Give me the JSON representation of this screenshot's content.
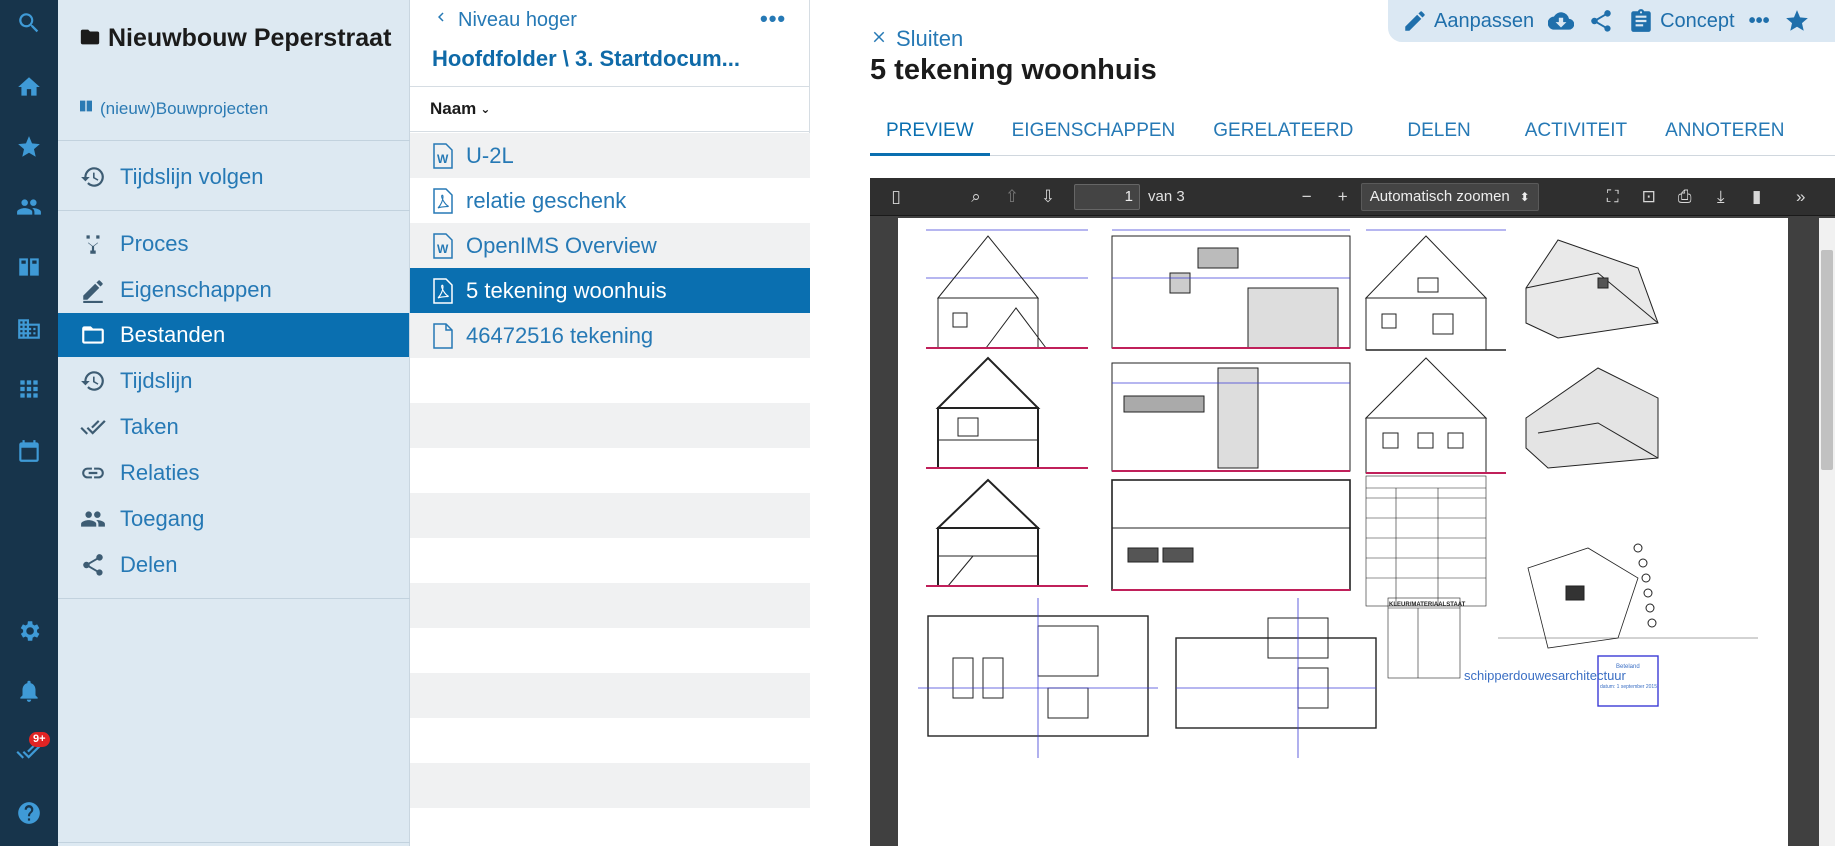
{
  "rail": {
    "icons": [
      "search-icon",
      "home-icon",
      "star-icon",
      "people-icon",
      "book-icon",
      "building-icon",
      "apps-icon",
      "calendar-icon",
      "gear-icon",
      "bell-icon",
      "tasks-icon",
      "help-icon"
    ],
    "badge": "9+"
  },
  "project": {
    "title": "Nieuwbouw Peperstraat",
    "subtitle": "(nieuw)Bouwprojecten",
    "follow": "Tijdslijn volgen",
    "nav": [
      {
        "label": "Proces",
        "icon": "process-icon"
      },
      {
        "label": "Eigenschappen",
        "icon": "edit-signature-icon"
      },
      {
        "label": "Bestanden",
        "icon": "folder-icon",
        "active": true
      },
      {
        "label": "Tijdslijn",
        "icon": "history-icon"
      },
      {
        "label": "Taken",
        "icon": "double-check-icon"
      },
      {
        "label": "Relaties",
        "icon": "link-icon"
      },
      {
        "label": "Toegang",
        "icon": "people-icon"
      },
      {
        "label": "Delen",
        "icon": "share-icon"
      }
    ]
  },
  "files": {
    "back_label": "Niveau hoger",
    "more": "•••",
    "path": "Hoofdfolder \\ 3. Startdocum...",
    "column_name": "Naam",
    "items": [
      {
        "name": "U-2L",
        "type": "word"
      },
      {
        "name": "relatie geschenk",
        "type": "pdf"
      },
      {
        "name": "OpenIMS Overview",
        "type": "word"
      },
      {
        "name": "5 tekening woonhuis",
        "type": "pdf",
        "active": true
      },
      {
        "name": "46472516 tekening",
        "type": "file"
      }
    ]
  },
  "detail": {
    "toolbar": {
      "edit_label": "Aanpassen",
      "status_label": "Concept"
    },
    "close_label": "Sluiten",
    "title": "5 tekening woonhuis",
    "tabs": [
      "PREVIEW",
      "EIGENSCHAPPEN",
      "GERELATEERD",
      "DELEN",
      "ACTIVITEIT",
      "ANNOTEREN"
    ],
    "viewer": {
      "page": "1",
      "page_of": "van 3",
      "zoom": "Automatisch zoomen",
      "drawing": {
        "material_table_title": "KLEUR/MATERIAALSTAAT",
        "architect": "schipperdouwesarchitectuur",
        "stamp_brand": "Beteland",
        "stamp_date": "datum: 1 september 2015"
      }
    }
  },
  "colors": {
    "rail": "#17344b",
    "accent": "#0a6fb0",
    "panel": "#dde9f2"
  }
}
